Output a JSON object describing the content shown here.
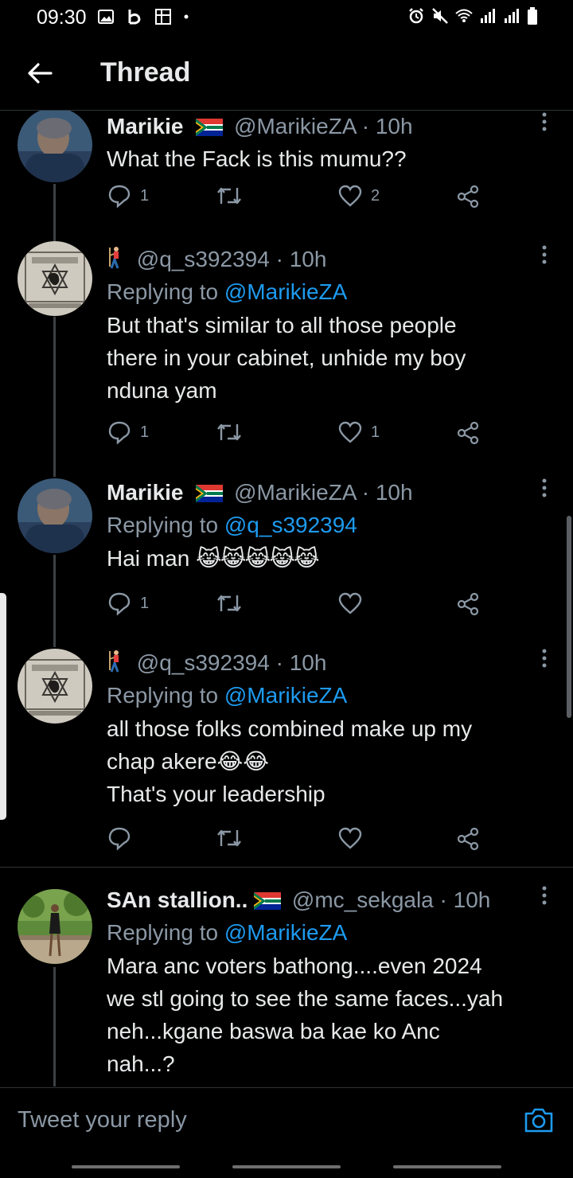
{
  "status_bar": {
    "time": "09:30"
  },
  "header": {
    "title": "Thread"
  },
  "tweets": [
    {
      "name": "Marikie",
      "handle": "@MarikieZA",
      "sep": "·",
      "time": "10h",
      "text": "What the Fack is this mumu??",
      "replies": "1",
      "retweets": "",
      "likes": "2"
    },
    {
      "handle": "@q_s392394",
      "sep": "·",
      "time": "10h",
      "replying_prefix": "Replying to",
      "replying_to": "@MarikieZA",
      "text_lines": [
        "But that's similar to all those people",
        "there in your cabinet, unhide my boy",
        "nduna yam"
      ],
      "replies": "1",
      "retweets": "",
      "likes": "1"
    },
    {
      "name": "Marikie",
      "handle": "@MarikieZA",
      "sep": "·",
      "time": "10h",
      "replying_prefix": "Replying to",
      "replying_to": "@q_s392394",
      "text": "Hai man",
      "emoji": "😹😹😹😹😹",
      "replies": "1",
      "retweets": "",
      "likes": ""
    },
    {
      "handle": "@q_s392394",
      "sep": "·",
      "time": "10h",
      "replying_prefix": "Replying to",
      "replying_to": "@MarikieZA",
      "line1": "all those folks combined make up my",
      "line2": "chap akere",
      "line2_emoji": "😂😂",
      "line3": "That's your leadership",
      "replies": "",
      "retweets": "",
      "likes": ""
    },
    {
      "name": "SAn stallion..",
      "handle": "@mc_sekgala",
      "sep": "·",
      "time": "10h",
      "replying_prefix": "Replying to",
      "replying_to": "@MarikieZA",
      "text_lines": [
        "Mara anc voters bathong....even 2024",
        "we stl going to see the same faces...yah",
        "neh...kgane baswa ba kae ko Anc",
        "nah...?"
      ]
    }
  ],
  "composer": {
    "placeholder": "Tweet your reply"
  },
  "colors": {
    "accent": "#1d9bf0",
    "muted": "#8b98a5",
    "background": "#000000",
    "text": "#e7e9ea"
  },
  "icons": [
    "back-arrow-icon",
    "reply-icon",
    "retweet-icon",
    "like-icon",
    "share-icon",
    "more-icon",
    "camera-icon",
    "south-africa-flag-icon",
    "golfer-icon"
  ]
}
